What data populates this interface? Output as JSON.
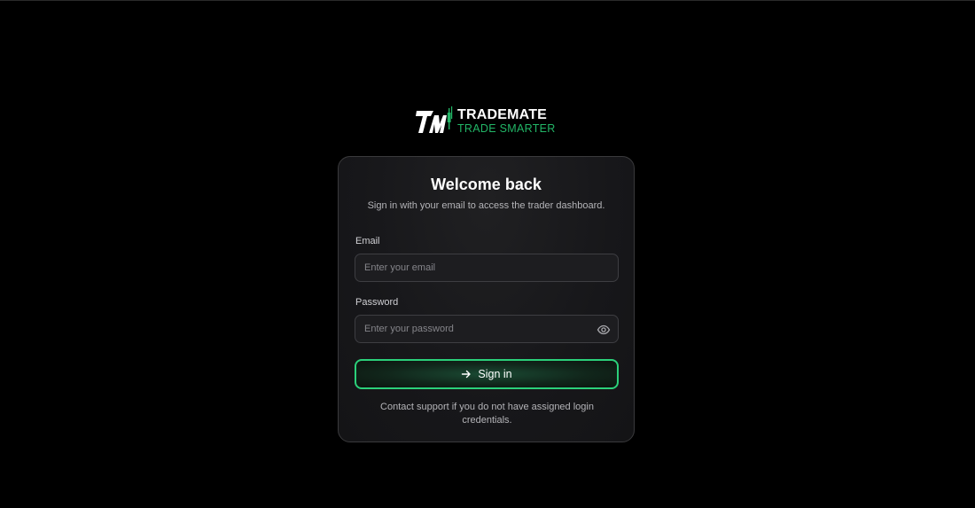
{
  "brand": {
    "name": "TRADEMATE",
    "tagline": "TRADE SMARTER",
    "accent_color": "#22b566",
    "logo_icon": "tm-candlestick-logo"
  },
  "login": {
    "title": "Welcome back",
    "subtitle": "Sign in with your email to access the trader dashboard.",
    "email": {
      "label": "Email",
      "placeholder": "Enter your email",
      "value": ""
    },
    "password": {
      "label": "Password",
      "placeholder": "Enter your password",
      "value": "",
      "toggle_icon": "eye-icon"
    },
    "submit": {
      "label": "Sign in",
      "icon": "arrow-right-icon",
      "border_color": "#2bd07a"
    },
    "support_note": "Contact support if you do not have assigned login credentials."
  }
}
